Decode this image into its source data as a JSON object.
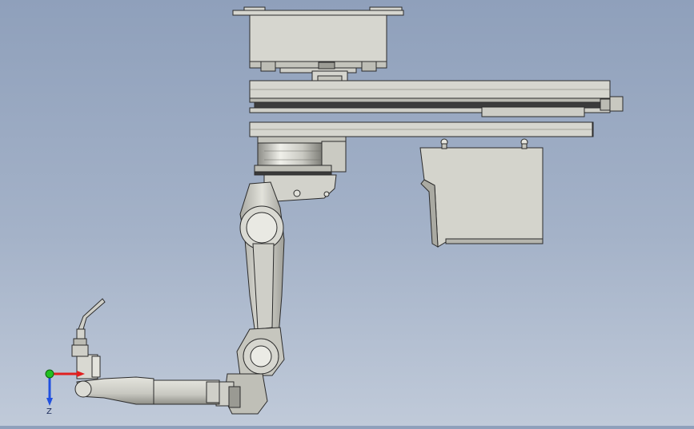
{
  "viewport": {
    "background_top": "#8fa0bb",
    "background_bottom": "#c0cad9",
    "part_fill": "#d6d6cf",
    "part_shade": "#b8b8b0",
    "edge_color": "#2b2b2b"
  },
  "triad": {
    "axes": [
      {
        "name": "x",
        "label": "",
        "color": "#e02020"
      },
      {
        "name": "y",
        "label": "",
        "color": "#20c020"
      },
      {
        "name": "z",
        "label": "Z",
        "color": "#2050e0"
      }
    ]
  }
}
